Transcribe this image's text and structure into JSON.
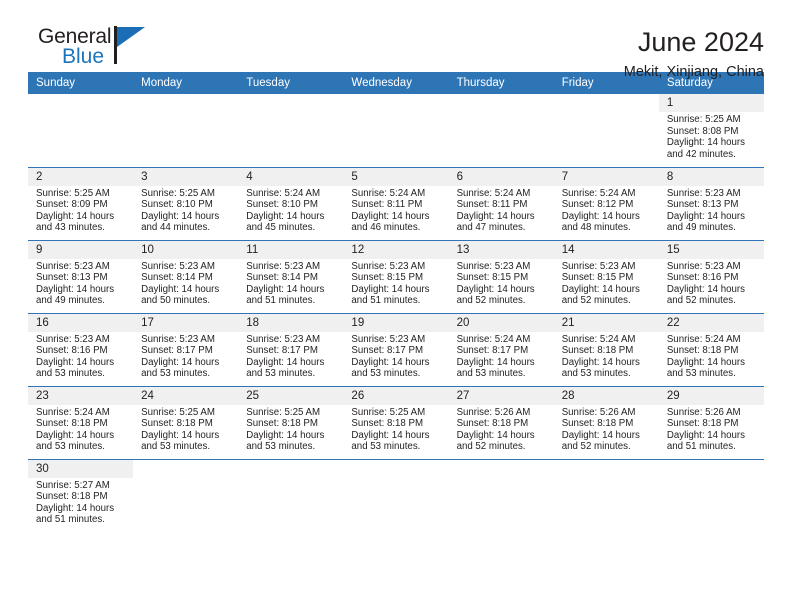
{
  "logo": {
    "word1": "General",
    "word2": "Blue",
    "triangle_color": "#1b6db5"
  },
  "header": {
    "title": "June 2024",
    "subtitle": "Mekit, Xinjiang, China"
  },
  "theme": {
    "header_blue": "#2e75b6",
    "daynum_gray": "#f0f0f0",
    "text": "#231f20"
  },
  "calendar": {
    "weekday_headers": [
      "Sunday",
      "Monday",
      "Tuesday",
      "Wednesday",
      "Thursday",
      "Friday",
      "Saturday"
    ],
    "labels": {
      "sunrise": "Sunrise:",
      "sunset": "Sunset:",
      "daylight": "Daylight:"
    },
    "weeks": [
      [
        {
          "day": "",
          "blank": true
        },
        {
          "day": "",
          "blank": true
        },
        {
          "day": "",
          "blank": true
        },
        {
          "day": "",
          "blank": true
        },
        {
          "day": "",
          "blank": true
        },
        {
          "day": "",
          "blank": true
        },
        {
          "day": "1",
          "sunrise": "Sunrise: 5:25 AM",
          "sunset": "Sunset: 8:08 PM",
          "daylight1": "Daylight: 14 hours",
          "daylight2": "and 42 minutes."
        }
      ],
      [
        {
          "day": "2",
          "sunrise": "Sunrise: 5:25 AM",
          "sunset": "Sunset: 8:09 PM",
          "daylight1": "Daylight: 14 hours",
          "daylight2": "and 43 minutes."
        },
        {
          "day": "3",
          "sunrise": "Sunrise: 5:25 AM",
          "sunset": "Sunset: 8:10 PM",
          "daylight1": "Daylight: 14 hours",
          "daylight2": "and 44 minutes."
        },
        {
          "day": "4",
          "sunrise": "Sunrise: 5:24 AM",
          "sunset": "Sunset: 8:10 PM",
          "daylight1": "Daylight: 14 hours",
          "daylight2": "and 45 minutes."
        },
        {
          "day": "5",
          "sunrise": "Sunrise: 5:24 AM",
          "sunset": "Sunset: 8:11 PM",
          "daylight1": "Daylight: 14 hours",
          "daylight2": "and 46 minutes."
        },
        {
          "day": "6",
          "sunrise": "Sunrise: 5:24 AM",
          "sunset": "Sunset: 8:11 PM",
          "daylight1": "Daylight: 14 hours",
          "daylight2": "and 47 minutes."
        },
        {
          "day": "7",
          "sunrise": "Sunrise: 5:24 AM",
          "sunset": "Sunset: 8:12 PM",
          "daylight1": "Daylight: 14 hours",
          "daylight2": "and 48 minutes."
        },
        {
          "day": "8",
          "sunrise": "Sunrise: 5:23 AM",
          "sunset": "Sunset: 8:13 PM",
          "daylight1": "Daylight: 14 hours",
          "daylight2": "and 49 minutes."
        }
      ],
      [
        {
          "day": "9",
          "sunrise": "Sunrise: 5:23 AM",
          "sunset": "Sunset: 8:13 PM",
          "daylight1": "Daylight: 14 hours",
          "daylight2": "and 49 minutes."
        },
        {
          "day": "10",
          "sunrise": "Sunrise: 5:23 AM",
          "sunset": "Sunset: 8:14 PM",
          "daylight1": "Daylight: 14 hours",
          "daylight2": "and 50 minutes."
        },
        {
          "day": "11",
          "sunrise": "Sunrise: 5:23 AM",
          "sunset": "Sunset: 8:14 PM",
          "daylight1": "Daylight: 14 hours",
          "daylight2": "and 51 minutes."
        },
        {
          "day": "12",
          "sunrise": "Sunrise: 5:23 AM",
          "sunset": "Sunset: 8:15 PM",
          "daylight1": "Daylight: 14 hours",
          "daylight2": "and 51 minutes."
        },
        {
          "day": "13",
          "sunrise": "Sunrise: 5:23 AM",
          "sunset": "Sunset: 8:15 PM",
          "daylight1": "Daylight: 14 hours",
          "daylight2": "and 52 minutes."
        },
        {
          "day": "14",
          "sunrise": "Sunrise: 5:23 AM",
          "sunset": "Sunset: 8:15 PM",
          "daylight1": "Daylight: 14 hours",
          "daylight2": "and 52 minutes."
        },
        {
          "day": "15",
          "sunrise": "Sunrise: 5:23 AM",
          "sunset": "Sunset: 8:16 PM",
          "daylight1": "Daylight: 14 hours",
          "daylight2": "and 52 minutes."
        }
      ],
      [
        {
          "day": "16",
          "sunrise": "Sunrise: 5:23 AM",
          "sunset": "Sunset: 8:16 PM",
          "daylight1": "Daylight: 14 hours",
          "daylight2": "and 53 minutes."
        },
        {
          "day": "17",
          "sunrise": "Sunrise: 5:23 AM",
          "sunset": "Sunset: 8:17 PM",
          "daylight1": "Daylight: 14 hours",
          "daylight2": "and 53 minutes."
        },
        {
          "day": "18",
          "sunrise": "Sunrise: 5:23 AM",
          "sunset": "Sunset: 8:17 PM",
          "daylight1": "Daylight: 14 hours",
          "daylight2": "and 53 minutes."
        },
        {
          "day": "19",
          "sunrise": "Sunrise: 5:23 AM",
          "sunset": "Sunset: 8:17 PM",
          "daylight1": "Daylight: 14 hours",
          "daylight2": "and 53 minutes."
        },
        {
          "day": "20",
          "sunrise": "Sunrise: 5:24 AM",
          "sunset": "Sunset: 8:17 PM",
          "daylight1": "Daylight: 14 hours",
          "daylight2": "and 53 minutes."
        },
        {
          "day": "21",
          "sunrise": "Sunrise: 5:24 AM",
          "sunset": "Sunset: 8:18 PM",
          "daylight1": "Daylight: 14 hours",
          "daylight2": "and 53 minutes."
        },
        {
          "day": "22",
          "sunrise": "Sunrise: 5:24 AM",
          "sunset": "Sunset: 8:18 PM",
          "daylight1": "Daylight: 14 hours",
          "daylight2": "and 53 minutes."
        }
      ],
      [
        {
          "day": "23",
          "sunrise": "Sunrise: 5:24 AM",
          "sunset": "Sunset: 8:18 PM",
          "daylight1": "Daylight: 14 hours",
          "daylight2": "and 53 minutes."
        },
        {
          "day": "24",
          "sunrise": "Sunrise: 5:25 AM",
          "sunset": "Sunset: 8:18 PM",
          "daylight1": "Daylight: 14 hours",
          "daylight2": "and 53 minutes."
        },
        {
          "day": "25",
          "sunrise": "Sunrise: 5:25 AM",
          "sunset": "Sunset: 8:18 PM",
          "daylight1": "Daylight: 14 hours",
          "daylight2": "and 53 minutes."
        },
        {
          "day": "26",
          "sunrise": "Sunrise: 5:25 AM",
          "sunset": "Sunset: 8:18 PM",
          "daylight1": "Daylight: 14 hours",
          "daylight2": "and 53 minutes."
        },
        {
          "day": "27",
          "sunrise": "Sunrise: 5:26 AM",
          "sunset": "Sunset: 8:18 PM",
          "daylight1": "Daylight: 14 hours",
          "daylight2": "and 52 minutes."
        },
        {
          "day": "28",
          "sunrise": "Sunrise: 5:26 AM",
          "sunset": "Sunset: 8:18 PM",
          "daylight1": "Daylight: 14 hours",
          "daylight2": "and 52 minutes."
        },
        {
          "day": "29",
          "sunrise": "Sunrise: 5:26 AM",
          "sunset": "Sunset: 8:18 PM",
          "daylight1": "Daylight: 14 hours",
          "daylight2": "and 51 minutes."
        }
      ],
      [
        {
          "day": "30",
          "sunrise": "Sunrise: 5:27 AM",
          "sunset": "Sunset: 8:18 PM",
          "daylight1": "Daylight: 14 hours",
          "daylight2": "and 51 minutes."
        },
        {
          "day": "",
          "blank": true
        },
        {
          "day": "",
          "blank": true
        },
        {
          "day": "",
          "blank": true
        },
        {
          "day": "",
          "blank": true
        },
        {
          "day": "",
          "blank": true
        },
        {
          "day": "",
          "blank": true
        }
      ]
    ]
  }
}
